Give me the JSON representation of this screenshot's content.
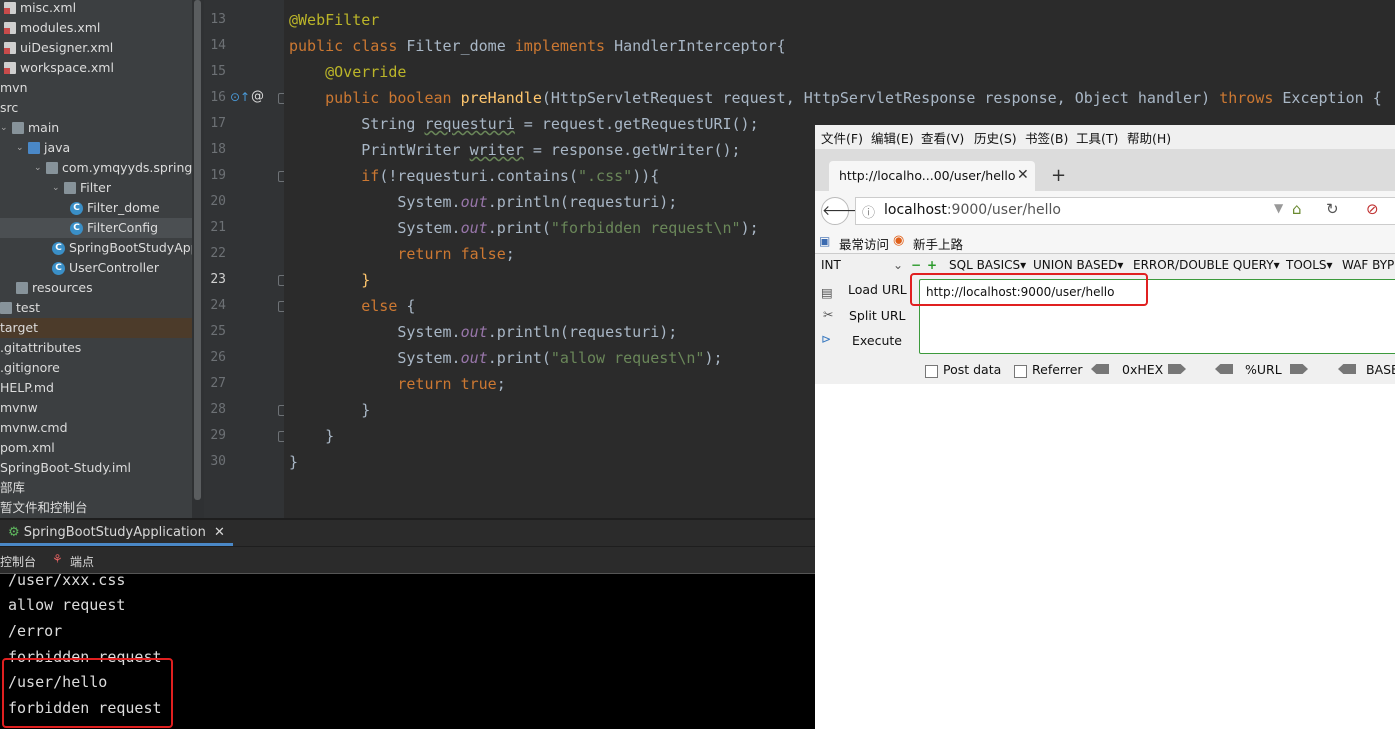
{
  "project_tree": [
    {
      "label": "misc.xml",
      "icon": "xml-file-icon",
      "indent": 0
    },
    {
      "label": "modules.xml",
      "icon": "xml-file-icon",
      "indent": 0
    },
    {
      "label": "uiDesigner.xml",
      "icon": "xml-file-icon",
      "indent": 0
    },
    {
      "label": "workspace.xml",
      "icon": "xml-file-icon",
      "indent": 0
    },
    {
      "label": "mvn",
      "icon": "none",
      "indent": 0
    },
    {
      "label": "src",
      "icon": "none",
      "indent": 0
    },
    {
      "label": "main",
      "icon": "folder-icon",
      "indent": 0
    },
    {
      "label": "java",
      "icon": "folder-blue-icon",
      "indent": 1
    },
    {
      "label": "com.ymqyyds.springboc",
      "icon": "package-icon",
      "indent": 2
    },
    {
      "label": "Filter",
      "icon": "package-icon",
      "indent": 3
    },
    {
      "label": "Filter_dome",
      "icon": "class-icon",
      "indent": 4
    },
    {
      "label": "FilterConfig",
      "icon": "class-icon",
      "indent": 4
    },
    {
      "label": "SpringBootStudyApp",
      "icon": "class-icon",
      "indent": 3
    },
    {
      "label": "UserController",
      "icon": "class-icon",
      "indent": 3
    },
    {
      "label": "resources",
      "icon": "folder-icon",
      "indent": 1
    },
    {
      "label": "test",
      "icon": "folder-icon",
      "indent": 0
    },
    {
      "label": "target",
      "icon": "none",
      "indent": 0
    },
    {
      "label": ".gitattributes",
      "icon": "none",
      "indent": 0
    },
    {
      "label": ".gitignore",
      "icon": "none",
      "indent": 0
    },
    {
      "label": "HELP.md",
      "icon": "none",
      "indent": 0
    },
    {
      "label": "mvnw",
      "icon": "none",
      "indent": 0
    },
    {
      "label": "mvnw.cmd",
      "icon": "none",
      "indent": 0
    },
    {
      "label": "pom.xml",
      "icon": "none",
      "indent": 0
    },
    {
      "label": "SpringBoot-Study.iml",
      "icon": "none",
      "indent": 0
    },
    {
      "label": "部库",
      "icon": "none",
      "indent": 0
    },
    {
      "label": "暂文件和控制台",
      "icon": "none",
      "indent": 0
    }
  ],
  "editor": {
    "line_numbers": [
      "13",
      "14",
      "15",
      "16",
      "17",
      "18",
      "19",
      "20",
      "21",
      "22",
      "23",
      "24",
      "25",
      "26",
      "27",
      "28",
      "29",
      "30"
    ],
    "highlighted_line": "23"
  },
  "run_panel": {
    "tab_label": "SpringBootStudyApplication",
    "tools": [
      "控制台",
      "端点"
    ]
  },
  "console": {
    "lines": [
      "/user/xxx.css",
      "allow request",
      "/error",
      "forbidden request",
      "/user/hello",
      "forbidden request"
    ]
  },
  "browser": {
    "menu": [
      "文件(F)",
      "编辑(E)",
      "查看(V)",
      "历史(S)",
      "书签(B)",
      "工具(T)",
      "帮助(H)"
    ],
    "tab_title": "http://localho...00/user/hello",
    "url_host": "localhost",
    "url_rest": ":9000/user/hello",
    "bookmarks": [
      "最常访问",
      "新手上路"
    ],
    "hackbar": {
      "select_value": "INT",
      "menus": [
        "SQL BASICS",
        "UNION BASED",
        "ERROR/DOUBLE QUERY",
        "TOOLS",
        "WAF BYP"
      ],
      "load_url": "Load URL",
      "split_url": "Split URL",
      "execute": "Execute",
      "url_value": "http://localhost:9000/user/hello",
      "post_data": "Post data",
      "referrer": "Referrer",
      "hex": "0xHEX",
      "url_enc": "%URL",
      "base": "BASE"
    }
  },
  "colors": {
    "editor_bg": "#2b2b2b",
    "keyword": "#cc7832",
    "annotation": "#bbb529",
    "function": "#ffc66d",
    "string": "#6a8759",
    "static": "#9876aa",
    "highlight": "#0f0f7a",
    "red_box": "#e02020"
  }
}
